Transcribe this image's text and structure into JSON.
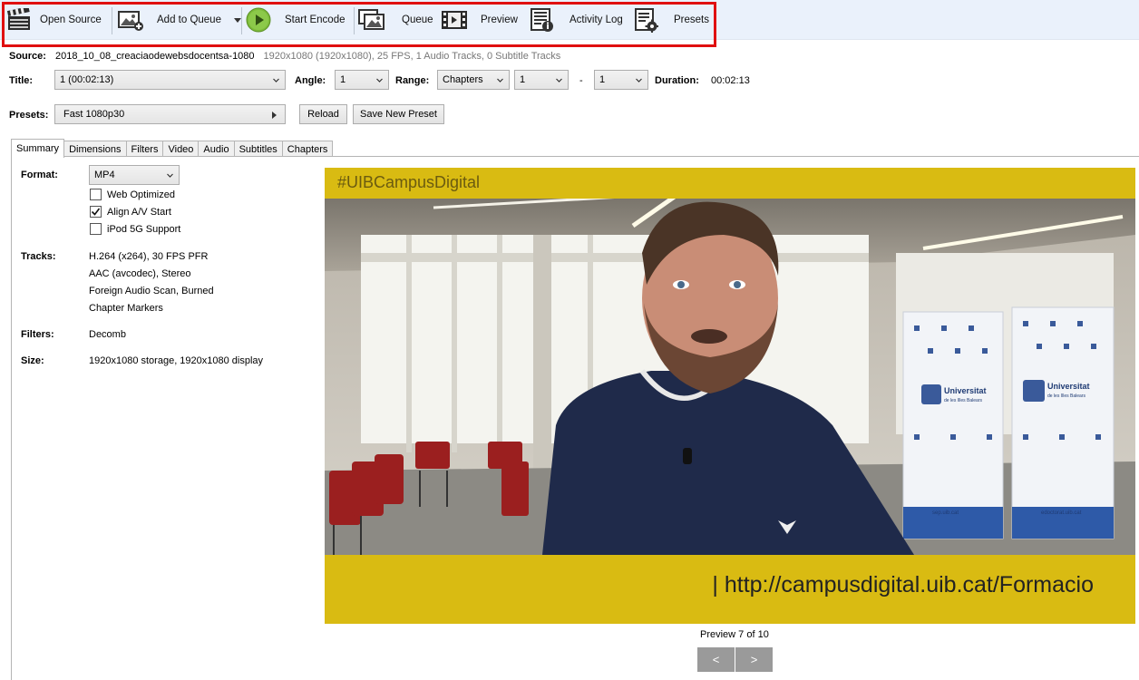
{
  "toolbar": {
    "open_source": "Open Source",
    "add_to_queue": "Add to Queue",
    "start_encode": "Start Encode",
    "queue": "Queue",
    "preview": "Preview",
    "activity_log": "Activity Log",
    "presets": "Presets",
    "icons": [
      "clapperboard-icon",
      "add-image-icon",
      "play-icon",
      "images-icon",
      "film-icon",
      "log-icon",
      "presets-gear-icon"
    ]
  },
  "source": {
    "label": "Source:",
    "name": "2018_10_08_creaciaodewebsdocentsa-1080",
    "details": "1920x1080 (1920x1080), 25 FPS, 1 Audio Tracks, 0 Subtitle Tracks"
  },
  "title_row": {
    "title_label": "Title:",
    "title_value": "1 (00:02:13)",
    "angle_label": "Angle:",
    "angle_value": "1",
    "range_label": "Range:",
    "range_mode": "Chapters",
    "range_start": "1",
    "range_dash": "-",
    "range_end": "1",
    "duration_label": "Duration:",
    "duration_value": "00:02:13"
  },
  "presets_row": {
    "label": "Presets:",
    "value": "Fast 1080p30",
    "reload": "Reload",
    "save_new": "Save New Preset"
  },
  "tabs": [
    "Summary",
    "Dimensions",
    "Filters",
    "Video",
    "Audio",
    "Subtitles",
    "Chapters"
  ],
  "summary": {
    "format_label": "Format:",
    "format_value": "MP4",
    "web_optimized": "Web Optimized",
    "align_av": "Align A/V Start",
    "ipod": "iPod 5G Support",
    "web_optimized_checked": false,
    "align_av_checked": true,
    "ipod_checked": false,
    "tracks_label": "Tracks:",
    "tracks": [
      "H.264 (x264), 30 FPS PFR",
      "AAC (avcodec), Stereo",
      "Foreign Audio Scan, Burned",
      "Chapter Markers"
    ],
    "filters_label": "Filters:",
    "filters_value": "Decomb",
    "size_label": "Size:",
    "size_value": "1920x1080 storage, 1920x1080 display"
  },
  "preview": {
    "hashtag": "#UIBCampusDigital",
    "url": "| http://campusdigital.uib.cat/Formacio",
    "banner_brand": "Universitat",
    "banner_sub": "de les Illes Balears",
    "banner_url_left": "sep.uib.cat",
    "banner_url_right": "edoctorat.uib.cat",
    "caption": "Preview 7 of 10",
    "prev": "<",
    "next": ">"
  },
  "colors": {
    "highlight": "#e01010",
    "toolbar_bg": "#eaf1fb",
    "video_yellow": "#d9bb12"
  }
}
